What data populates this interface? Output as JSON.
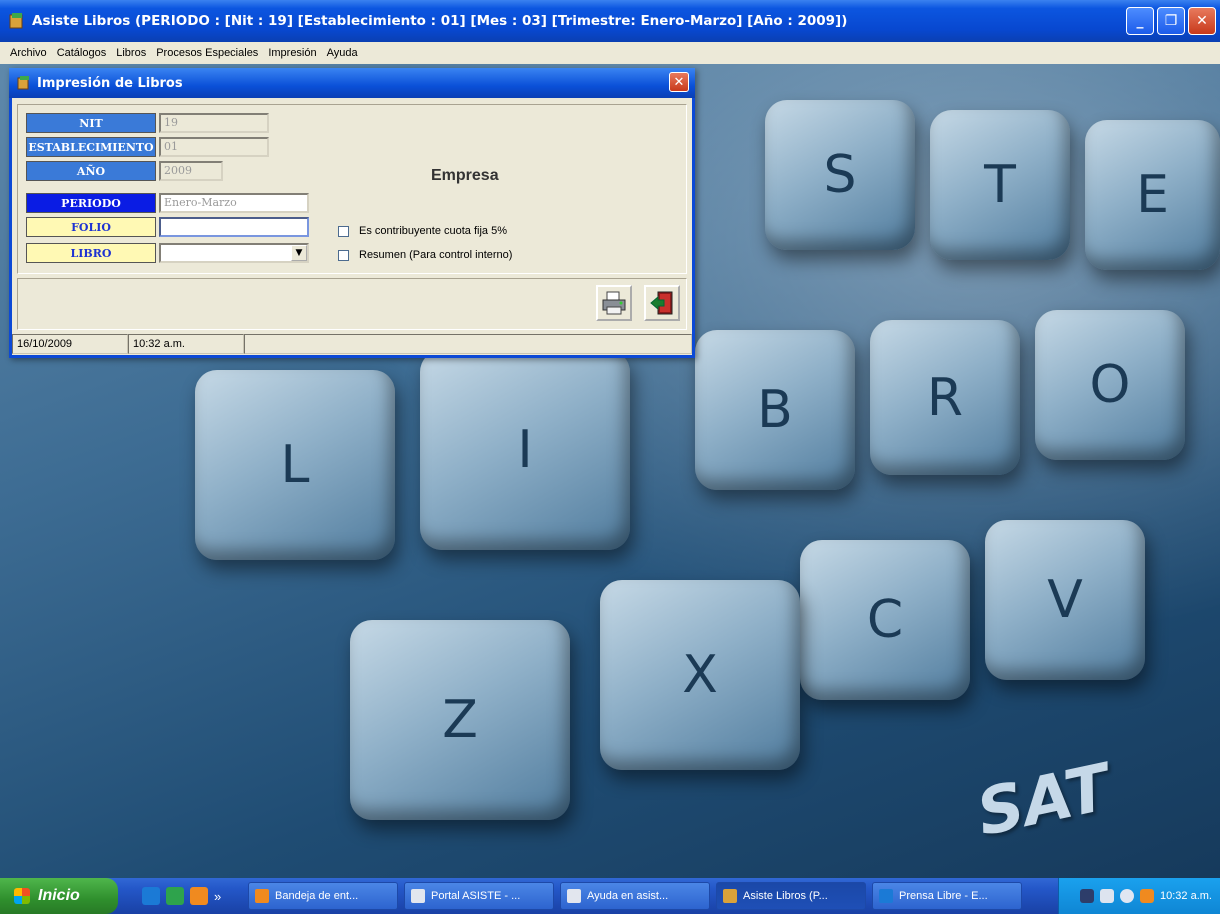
{
  "window": {
    "title": "Asiste Libros (PERIODO : [Nit : 19] [Establecimiento : 01] [Mes : 03] [Trimestre: Enero-Marzo] [Año : 2009])",
    "minimize": "_",
    "maximize": "❐",
    "close": "✕"
  },
  "menu": [
    "Archivo",
    "Catálogos",
    "Libros",
    "Procesos Especiales",
    "Impresión",
    "Ayuda"
  ],
  "desktop": {
    "keys": [
      "S",
      "T",
      "E",
      "B",
      "R",
      "O",
      "L",
      "I",
      "C",
      "V",
      "Z",
      "X"
    ],
    "logo": "SAT"
  },
  "dialog": {
    "title": "Impresión de Libros",
    "close": "✕",
    "labels": {
      "nit": "NIT",
      "establecimiento": "ESTABLECIMIENTO",
      "anio": "AÑO",
      "periodo": "PERIODO",
      "folio": "FOLIO",
      "libro": "LIBRO"
    },
    "values": {
      "nit": "19",
      "establecimiento": "01",
      "anio": "2009",
      "periodo": "Enero-Marzo",
      "folio": "",
      "libro": ""
    },
    "empresa": "Empresa",
    "checkboxes": {
      "cuota_fija": "Es contribuyente cuota fija 5%",
      "resumen": "Resumen (Para control interno)"
    },
    "status": {
      "date": "16/10/2009",
      "time": "10:32 a.m."
    }
  },
  "taskbar": {
    "start": "Inicio",
    "tasks": [
      "Bandeja de ent...",
      "Portal ASISTE - ...",
      "Ayuda en asist...",
      "Asiste Libros (P...",
      "Prensa Libre - E..."
    ],
    "clock": "10:32 a.m."
  },
  "colors": {
    "titlebar": "#0848d0",
    "dialog_bg": "#ece9d8",
    "label_blue": "#3a7ad8",
    "label_dark": "#0a1ce4",
    "label_yellow": "#fff9b4",
    "taskbar": "#2457c8",
    "start": "#2f8f2d"
  }
}
